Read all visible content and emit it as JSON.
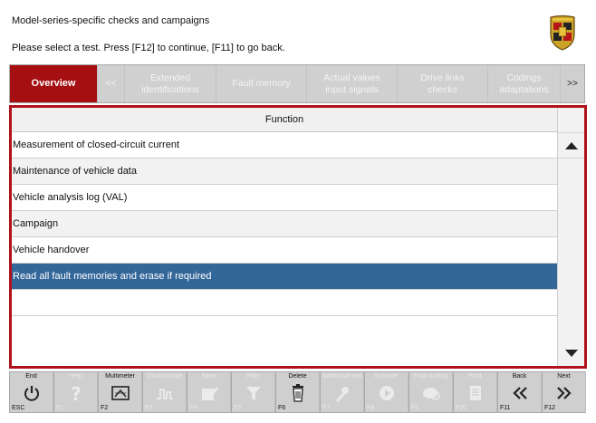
{
  "header": {
    "title": "Model-series-specific checks and campaigns",
    "instruction": "Please select a test. Press [F12] to continue, [F11] to go back."
  },
  "tabs": {
    "overview": "Overview",
    "prev": "<<",
    "extended": "Extended identifications",
    "fault_memory": "Fault memory",
    "actual_values": "Actual values input signals",
    "drive_links": "Drive links checks",
    "codings": "Codings adaptations",
    "next": ">>"
  },
  "table": {
    "column_header": "Function",
    "rows": [
      "Measurement of closed-circuit current",
      "Maintenance of vehicle data",
      "Vehicle analysis log (VAL)",
      "Campaign",
      "Vehicle handover",
      "Read all fault memories and erase if required"
    ],
    "selected_index": 5
  },
  "fkeys": [
    {
      "label": "End",
      "code": "ESC",
      "icon": "power-icon",
      "enabled": true
    },
    {
      "label": "Help",
      "code": "F1",
      "icon": "help-icon",
      "enabled": false
    },
    {
      "label": "Multimeter",
      "code": "F2",
      "icon": "multimeter-icon",
      "enabled": true
    },
    {
      "label": "Oscilloscope",
      "code": "F3",
      "icon": "oscilloscope-icon",
      "enabled": false
    },
    {
      "label": "Save",
      "code": "F4",
      "icon": "save-icon",
      "enabled": false
    },
    {
      "label": "Filter",
      "code": "F5",
      "icon": "filter-icon",
      "enabled": false
    },
    {
      "label": "Delete",
      "code": "F6",
      "icon": "delete-icon",
      "enabled": true
    },
    {
      "label": "Additional test",
      "code": "F7",
      "icon": "tools-icon",
      "enabled": false
    },
    {
      "label": "Execute",
      "code": "F8",
      "icon": "play-icon",
      "enabled": false
    },
    {
      "label": "Fault finding",
      "code": "F9",
      "icon": "fault-finding-icon",
      "enabled": false
    },
    {
      "label": "Print",
      "code": "F10",
      "icon": "document-icon",
      "enabled": false
    },
    {
      "label": "Back",
      "code": "F11",
      "icon": "back-icon",
      "enabled": true
    },
    {
      "label": "Next",
      "code": "F12",
      "icon": "next-icon",
      "enabled": true
    }
  ],
  "colors": {
    "accent_red": "#a50f12",
    "selection_blue": "#336699"
  }
}
